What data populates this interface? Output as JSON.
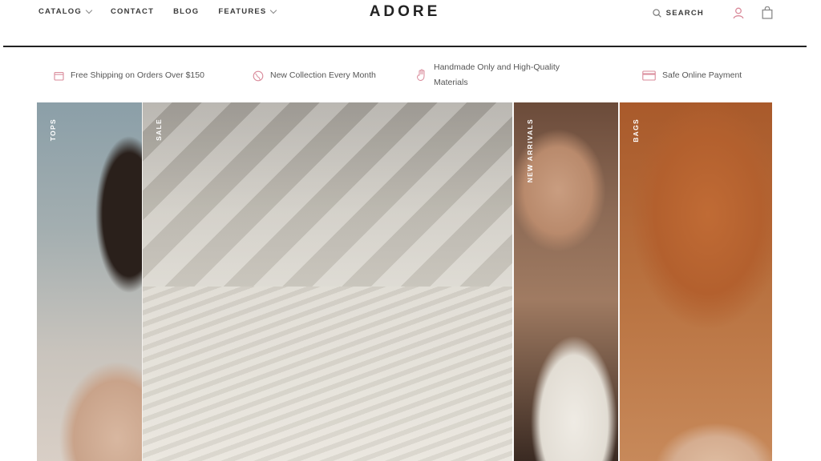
{
  "header": {
    "nav": [
      {
        "label": "CATALOG",
        "has_dropdown": true
      },
      {
        "label": "CONTACT",
        "has_dropdown": false
      },
      {
        "label": "BLOG",
        "has_dropdown": false
      },
      {
        "label": "FEATURES",
        "has_dropdown": true
      }
    ],
    "logo": "ADORE",
    "search_label": "SEARCH",
    "icons": [
      "search-icon",
      "account-icon",
      "cart-icon"
    ],
    "accent_color": "#d98a9a"
  },
  "features": [
    {
      "icon": "box-icon",
      "text": "Free Shipping on Orders Over $150"
    },
    {
      "icon": "globe-icon",
      "text": "New Collection Every Month"
    },
    {
      "icon": "hand-icon",
      "text_line1": "Handmade Only and High-Quality",
      "text_line2": "Materials"
    },
    {
      "icon": "card-icon",
      "text": "Safe Online Payment"
    }
  ],
  "hero": {
    "panels": [
      {
        "label": "TOPS"
      },
      {
        "label": "SALE"
      },
      {
        "label": "NEW ARRIVALS"
      },
      {
        "label": "BAGS"
      }
    ]
  }
}
